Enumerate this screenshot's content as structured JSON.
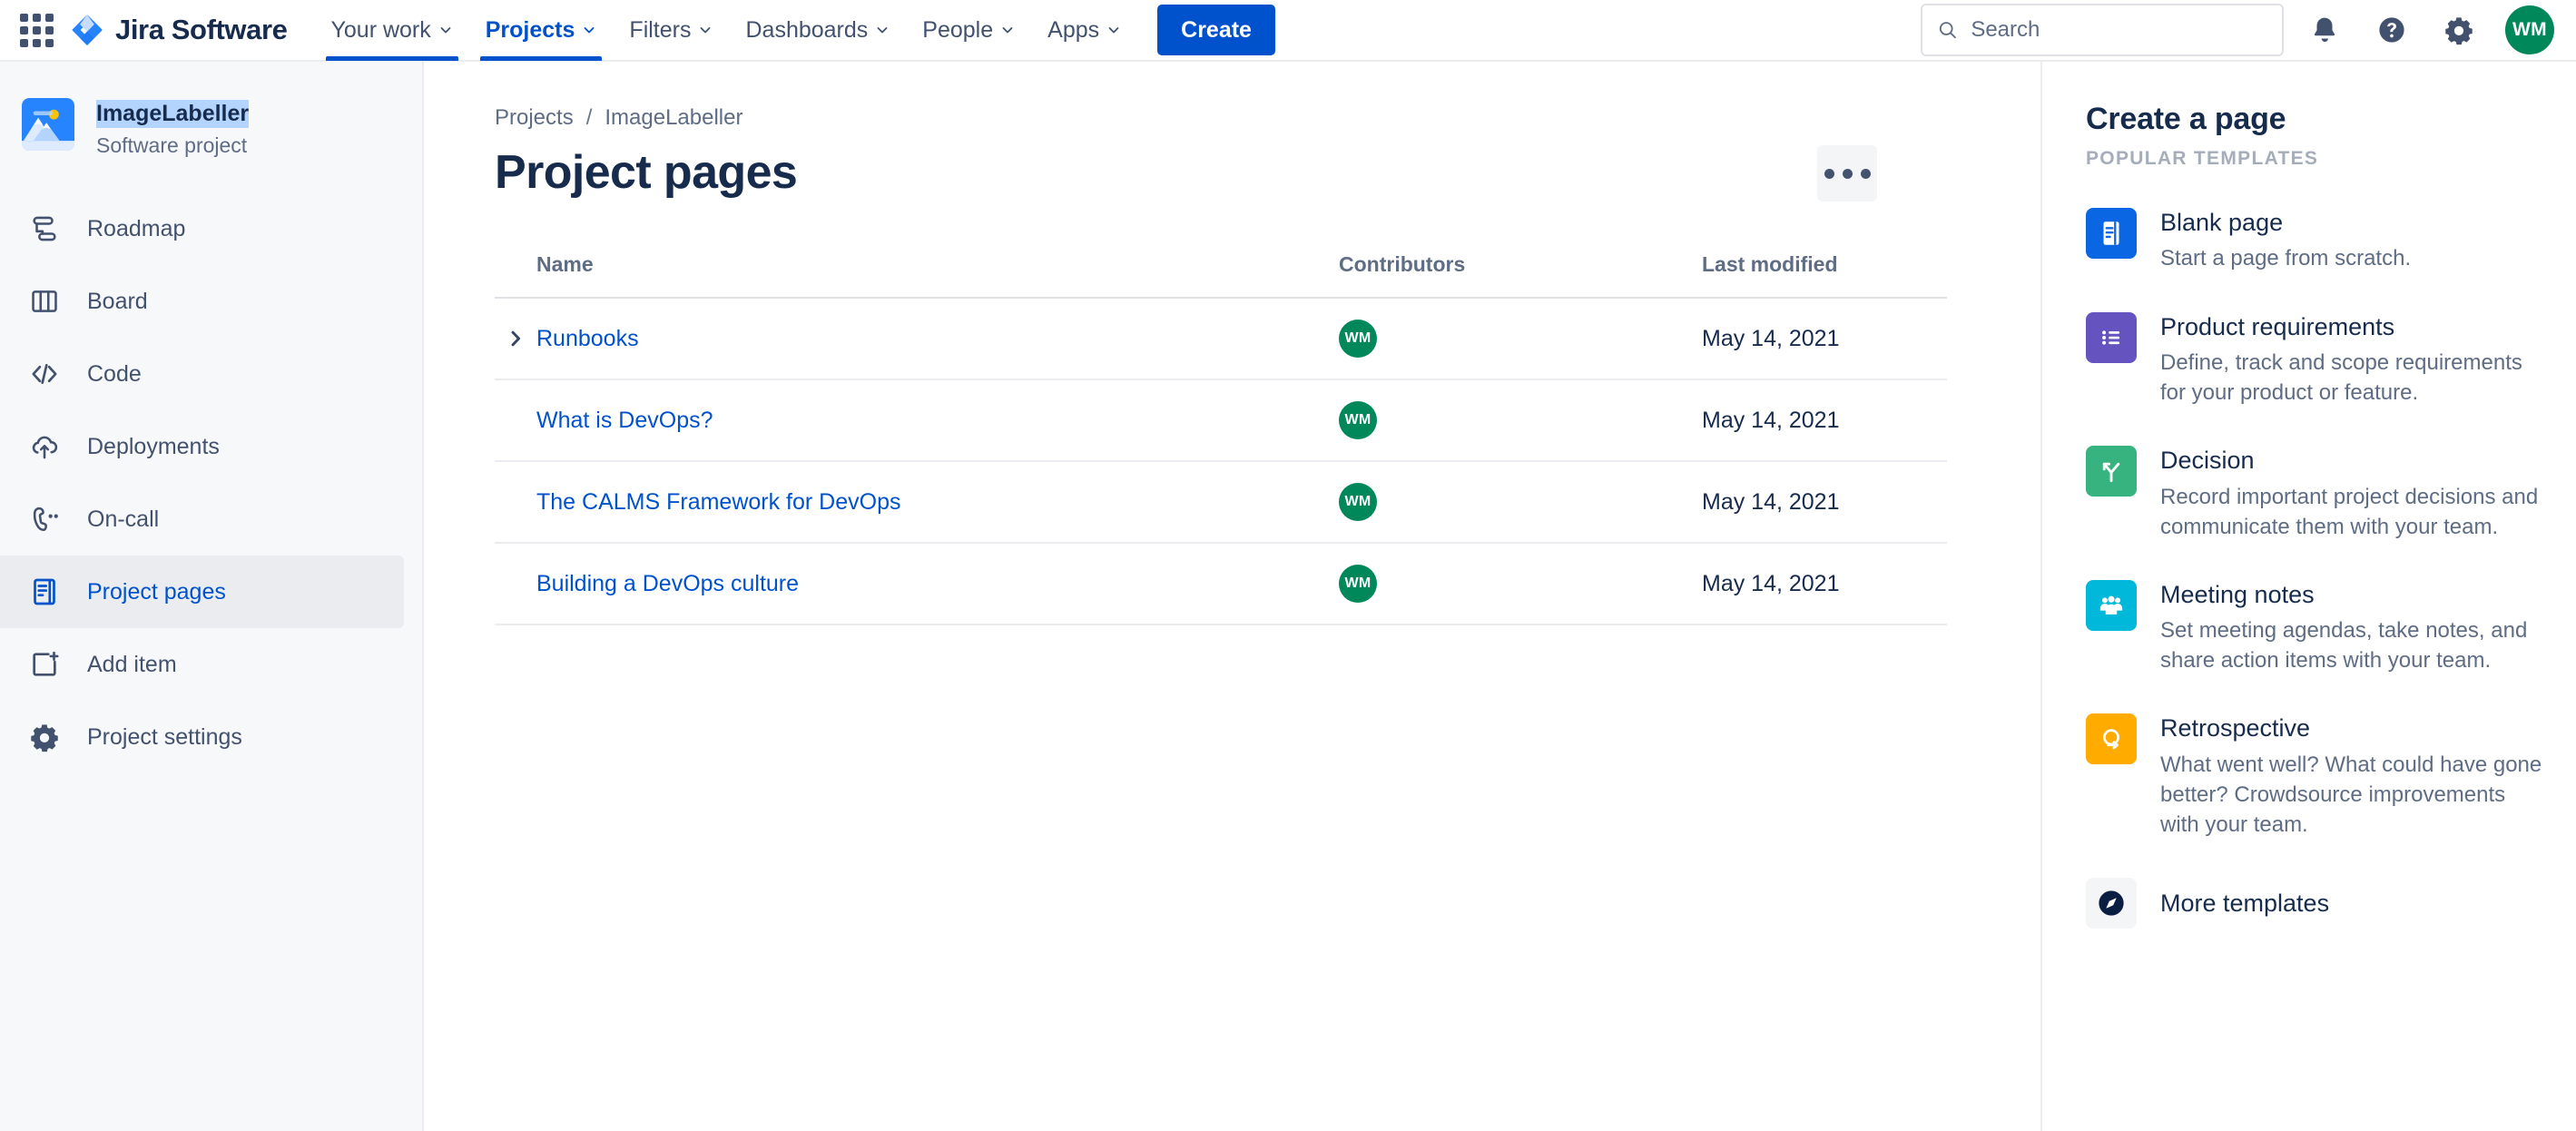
{
  "topnav": {
    "app_switcher_icon": "apps-grid-icon",
    "logo_icon": "jira-logo-icon",
    "product_name": "Jira Software",
    "items": [
      {
        "label": "Your work",
        "active": false
      },
      {
        "label": "Projects",
        "active": true
      },
      {
        "label": "Filters",
        "active": false
      },
      {
        "label": "Dashboards",
        "active": false
      },
      {
        "label": "People",
        "active": false
      },
      {
        "label": "Apps",
        "active": false
      }
    ],
    "create_label": "Create",
    "search": {
      "placeholder": "Search",
      "value": "",
      "icon": "search-icon"
    },
    "notifications_icon": "bell-icon",
    "help_icon": "help-circle-icon",
    "settings_icon": "gear-icon",
    "avatar": {
      "initials": "WM",
      "color": "#00875A"
    }
  },
  "sidebar": {
    "project": {
      "name": "ImageLabeller",
      "type": "Software project",
      "avatar_icon": "mountain-image-icon",
      "name_selected": true,
      "selection_color": "#B3D4FF"
    },
    "items": [
      {
        "label": "Roadmap",
        "icon": "roadmap-icon",
        "active": false
      },
      {
        "label": "Board",
        "icon": "board-columns-icon",
        "active": false
      },
      {
        "label": "Code",
        "icon": "code-brackets-icon",
        "active": false
      },
      {
        "label": "Deployments",
        "icon": "cloud-upload-icon",
        "active": false
      },
      {
        "label": "On-call",
        "icon": "phone-oncall-icon",
        "active": false
      },
      {
        "label": "Project pages",
        "icon": "page-document-icon",
        "active": true
      },
      {
        "label": "Add item",
        "icon": "add-item-icon",
        "active": false
      },
      {
        "label": "Project settings",
        "icon": "gear-icon",
        "active": false
      }
    ]
  },
  "main": {
    "breadcrumb": [
      "Projects",
      "ImageLabeller"
    ],
    "breadcrumb_separator": "/",
    "title": "Project pages",
    "more_actions_icon": "more-horizontal-icon",
    "table": {
      "columns": [
        "Name",
        "Contributors",
        "Last modified"
      ],
      "rows": [
        {
          "name": "Runbooks",
          "expandable": true,
          "chevron_icon": "chevron-right-icon",
          "contributor": "WM",
          "modified": "May 14, 2021"
        },
        {
          "name": "What is DevOps?",
          "expandable": false,
          "contributor": "WM",
          "modified": "May 14, 2021"
        },
        {
          "name": "The CALMS Framework for DevOps",
          "expandable": false,
          "contributor": "WM",
          "modified": "May 14, 2021"
        },
        {
          "name": "Building a DevOps culture",
          "expandable": false,
          "contributor": "WM",
          "modified": "May 14, 2021"
        }
      ]
    }
  },
  "rightpanel": {
    "title": "Create a page",
    "subtitle": "POPULAR TEMPLATES",
    "templates": [
      {
        "name": "Blank page",
        "desc": "Start a page from scratch.",
        "icon": "blank-page-icon",
        "color": "#0B66E4"
      },
      {
        "name": "Product requirements",
        "desc": "Define, track and scope requirements for your product or feature.",
        "icon": "bullet-list-icon",
        "color": "#6554C0"
      },
      {
        "name": "Decision",
        "desc": "Record important project decisions and communicate them with your team.",
        "icon": "fork-arrow-icon",
        "color": "#36B37E"
      },
      {
        "name": "Meeting notes",
        "desc": "Set meeting agendas, take notes, and share action items with your team.",
        "icon": "people-group-icon",
        "color": "#00B8D9"
      },
      {
        "name": "Retrospective",
        "desc": "What went well? What could have gone better? Crowdsource improvements with your team.",
        "icon": "retrospective-loop-icon",
        "color": "#FFAB00"
      }
    ],
    "more_templates": {
      "label": "More templates",
      "icon": "compass-icon",
      "color": "#091E42"
    }
  }
}
